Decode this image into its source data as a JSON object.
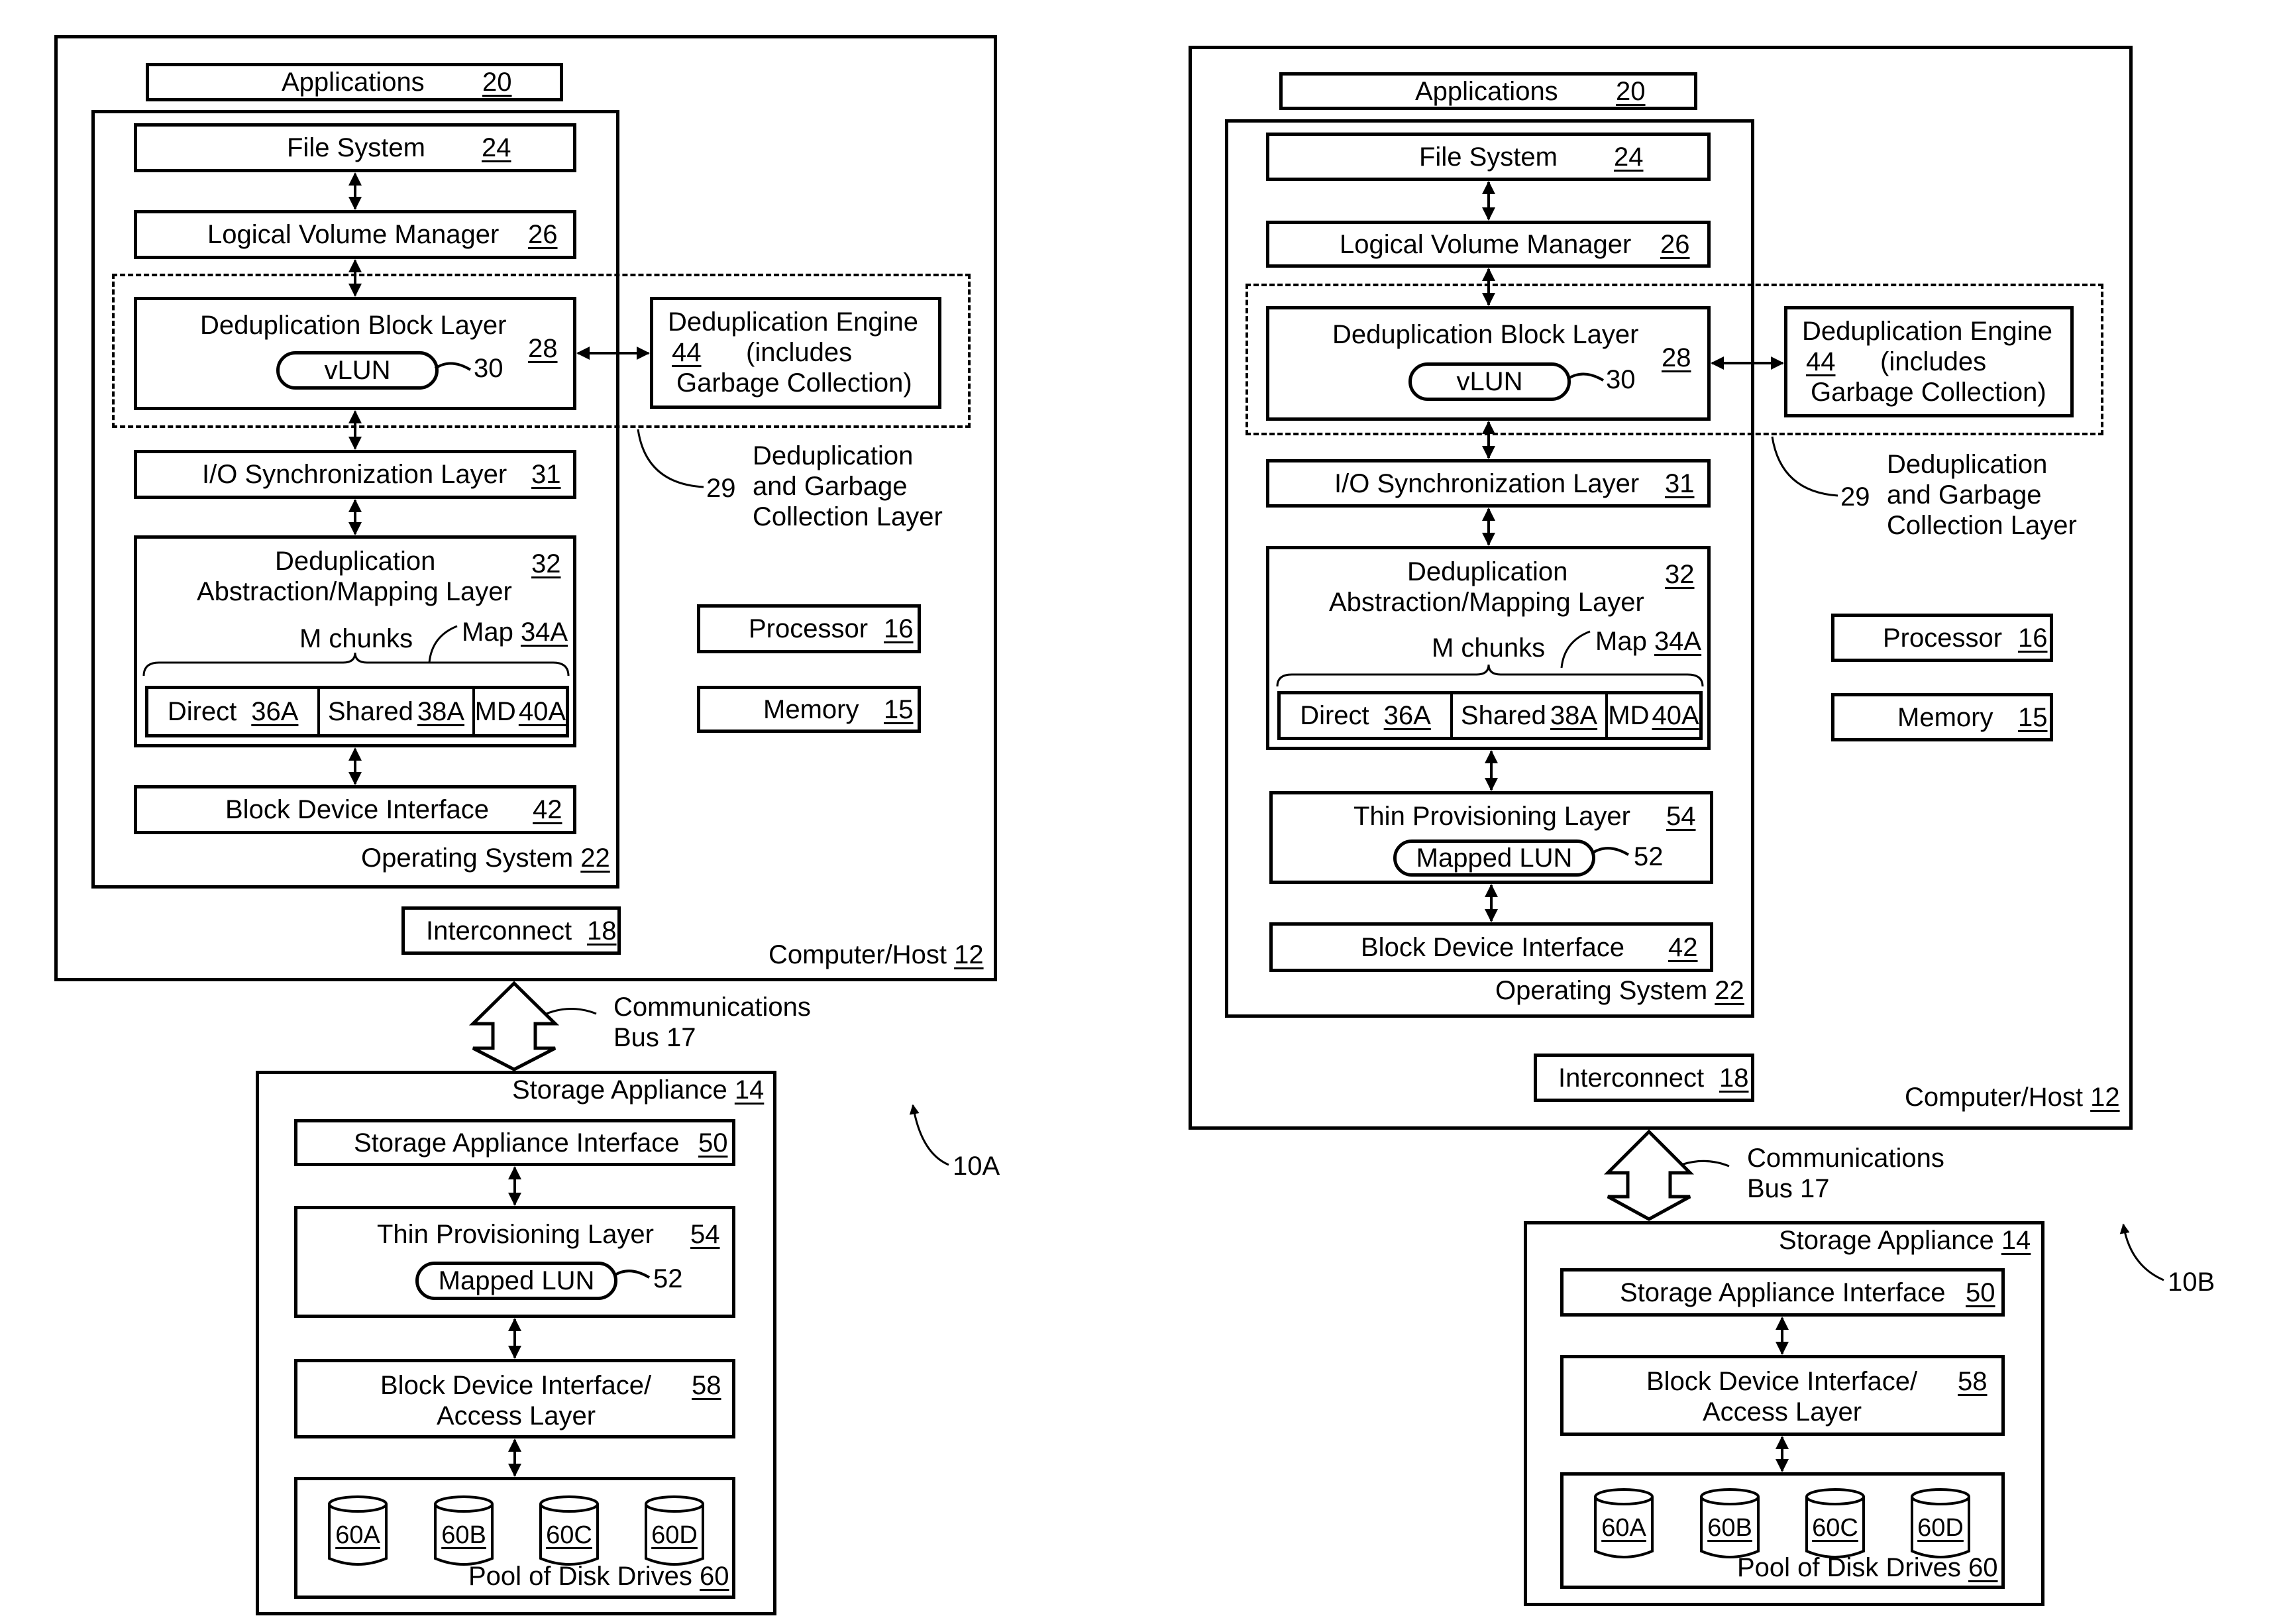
{
  "diagrams": [
    {
      "figure_label": "10A",
      "host": {
        "label": "Computer/Host",
        "ref": "12"
      },
      "applications": {
        "label": "Applications",
        "ref": "20"
      },
      "operating_system": {
        "label": "Operating System",
        "ref": "22"
      },
      "file_system": {
        "label": "File System",
        "ref": "24"
      },
      "lvm": {
        "label": "Logical Volume Manager",
        "ref": "26"
      },
      "dedup_block_layer": {
        "label": "Deduplication Block Layer",
        "ref": "28",
        "vlun": "vLUN",
        "vlun_ref": "30"
      },
      "dedup_engine": {
        "line1": "Deduplication Engine",
        "ref": "44",
        "line2": "(includes",
        "line3": "Garbage Collection)"
      },
      "dedup_gc_layer": {
        "ref": "29",
        "line1": "Deduplication",
        "line2": "and Garbage",
        "line3": "Collection Layer"
      },
      "io_sync": {
        "label": "I/O Synchronization Layer",
        "ref": "31"
      },
      "dedup_mapping": {
        "line1": "Deduplication",
        "line2": "Abstraction/Mapping Layer",
        "ref": "32",
        "chunks": "M chunks",
        "map_label": "Map",
        "map_ref": "34A",
        "cells": [
          {
            "label": "Direct",
            "ref": "36A"
          },
          {
            "label": "Shared",
            "ref": "38A"
          },
          {
            "label": "MD",
            "ref": "40A"
          }
        ]
      },
      "thin_provisioning": null,
      "block_device_interface": {
        "label": "Block Device Interface",
        "ref": "42"
      },
      "processor": {
        "label": "Processor",
        "ref": "16"
      },
      "memory": {
        "label": "Memory",
        "ref": "15"
      },
      "interconnect": {
        "label": "Interconnect",
        "ref": "18"
      },
      "bus": {
        "line1": "Communications",
        "line2": "Bus 17"
      },
      "storage_appliance": {
        "label": "Storage Appliance",
        "ref": "14",
        "interface": {
          "label": "Storage Appliance Interface",
          "ref": "50"
        },
        "thin_provisioning": {
          "label": "Thin Provisioning Layer",
          "ref": "54",
          "lun": "Mapped LUN",
          "lun_ref": "52"
        },
        "access_layer": {
          "line1": "Block Device Interface/",
          "line2": "Access Layer",
          "ref": "58"
        },
        "pool": {
          "label": "Pool of Disk Drives",
          "ref": "60",
          "drives": [
            "60A",
            "60B",
            "60C",
            "60D"
          ]
        }
      }
    },
    {
      "figure_label": "10B",
      "host": {
        "label": "Computer/Host",
        "ref": "12"
      },
      "applications": {
        "label": "Applications",
        "ref": "20"
      },
      "operating_system": {
        "label": "Operating System",
        "ref": "22"
      },
      "file_system": {
        "label": "File System",
        "ref": "24"
      },
      "lvm": {
        "label": "Logical Volume Manager",
        "ref": "26"
      },
      "dedup_block_layer": {
        "label": "Deduplication Block Layer",
        "ref": "28",
        "vlun": "vLUN",
        "vlun_ref": "30"
      },
      "dedup_engine": {
        "line1": "Deduplication Engine",
        "ref": "44",
        "line2": "(includes",
        "line3": "Garbage Collection)"
      },
      "dedup_gc_layer": {
        "ref": "29",
        "line1": "Deduplication",
        "line2": "and Garbage",
        "line3": "Collection Layer"
      },
      "io_sync": {
        "label": "I/O Synchronization Layer",
        "ref": "31"
      },
      "dedup_mapping": {
        "line1": "Deduplication",
        "line2": "Abstraction/Mapping Layer",
        "ref": "32",
        "chunks": "M chunks",
        "map_label": "Map",
        "map_ref": "34A",
        "cells": [
          {
            "label": "Direct",
            "ref": "36A"
          },
          {
            "label": "Shared",
            "ref": "38A"
          },
          {
            "label": "MD",
            "ref": "40A"
          }
        ]
      },
      "thin_provisioning": {
        "label": "Thin Provisioning Layer",
        "ref": "54",
        "lun": "Mapped LUN",
        "lun_ref": "52"
      },
      "block_device_interface": {
        "label": "Block Device Interface",
        "ref": "42"
      },
      "processor": {
        "label": "Processor",
        "ref": "16"
      },
      "memory": {
        "label": "Memory",
        "ref": "15"
      },
      "interconnect": {
        "label": "Interconnect",
        "ref": "18"
      },
      "bus": {
        "line1": "Communications",
        "line2": "Bus 17"
      },
      "storage_appliance": {
        "label": "Storage Appliance",
        "ref": "14",
        "interface": {
          "label": "Storage Appliance Interface",
          "ref": "50"
        },
        "thin_provisioning": null,
        "access_layer": {
          "line1": "Block Device Interface/",
          "line2": "Access Layer",
          "ref": "58"
        },
        "pool": {
          "label": "Pool of Disk Drives",
          "ref": "60",
          "drives": [
            "60A",
            "60B",
            "60C",
            "60D"
          ]
        }
      }
    }
  ]
}
